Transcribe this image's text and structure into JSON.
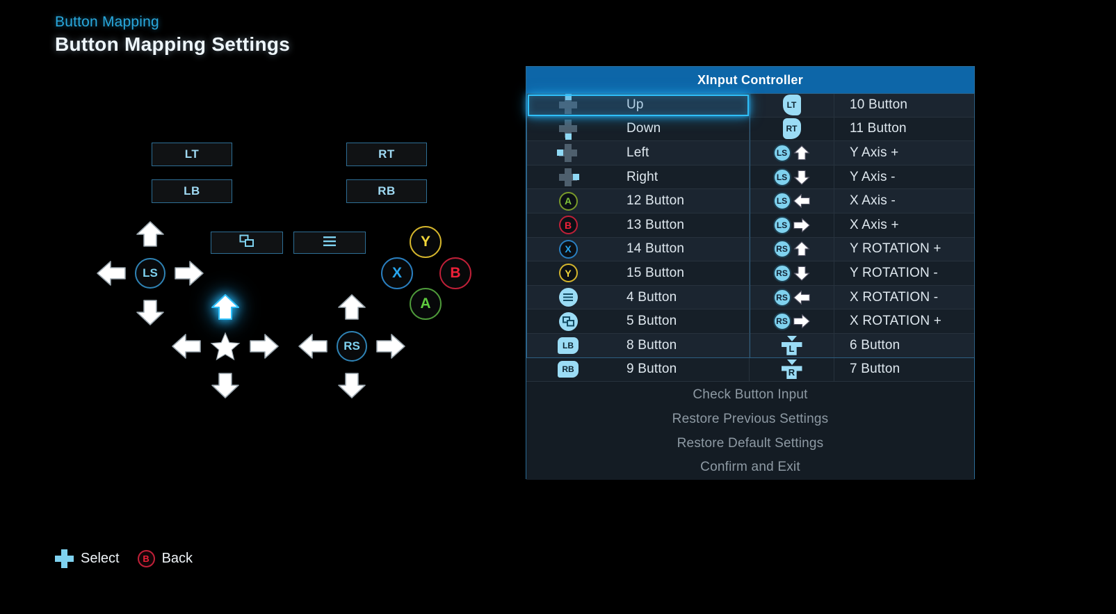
{
  "header": {
    "breadcrumb": "Button Mapping",
    "title": "Button Mapping Settings"
  },
  "controller_diagram": {
    "shoulders": [
      {
        "id": "lt",
        "label": "LT"
      },
      {
        "id": "lb",
        "label": "LB"
      },
      {
        "id": "rt",
        "label": "RT"
      },
      {
        "id": "rb",
        "label": "RB"
      }
    ],
    "center_buttons": [
      {
        "id": "view",
        "icon": "view-windows-icon"
      },
      {
        "id": "menu",
        "icon": "menu-hamburger-icon"
      }
    ],
    "left_stick": {
      "hub_label": "LS",
      "directions": [
        "up",
        "left",
        "right",
        "down"
      ]
    },
    "dpad": {
      "hub_icon": "star-icon",
      "directions": [
        "up",
        "left",
        "right",
        "down"
      ],
      "selected": "up"
    },
    "right_stick": {
      "hub_label": "RS",
      "directions": [
        "up",
        "left",
        "right",
        "down"
      ]
    },
    "face_buttons": [
      {
        "id": "y",
        "label": "Y",
        "color": "#f2d63a"
      },
      {
        "id": "x",
        "label": "X",
        "color": "#27a6ef"
      },
      {
        "id": "b",
        "label": "B",
        "color": "#ef2038"
      },
      {
        "id": "a",
        "label": "A",
        "color": "#5fcb3f"
      }
    ]
  },
  "panel": {
    "title": "XInput Controller",
    "selected_row_index": 0,
    "rows": [
      {
        "icon": "dpad-up-icon",
        "label": "Up",
        "icon2": "lt-trigger-icon",
        "label2": "10 Button"
      },
      {
        "icon": "dpad-down-icon",
        "label": "Down",
        "icon2": "rt-trigger-icon",
        "label2": "11 Button"
      },
      {
        "icon": "dpad-left-icon",
        "label": "Left",
        "icon2": "ls-up-icon",
        "label2": "Y Axis +"
      },
      {
        "icon": "dpad-right-icon",
        "label": "Right",
        "icon2": "ls-down-icon",
        "label2": "Y Axis -"
      },
      {
        "icon": "button-a-icon",
        "label": "12 Button",
        "icon2": "ls-left-icon",
        "label2": "X Axis -"
      },
      {
        "icon": "button-b-icon",
        "label": "13 Button",
        "icon2": "ls-right-icon",
        "label2": "X Axis +"
      },
      {
        "icon": "button-x-icon",
        "label": "14 Button",
        "icon2": "rs-up-icon",
        "label2": "Y ROTATION +"
      },
      {
        "icon": "button-y-icon",
        "label": "15 Button",
        "icon2": "rs-down-icon",
        "label2": "Y ROTATION -"
      },
      {
        "icon": "menu-hamburger-icon",
        "label": "4 Button",
        "icon2": "rs-left-icon",
        "label2": "X ROTATION -"
      },
      {
        "icon": "view-windows-icon",
        "label": "5 Button",
        "icon2": "rs-right-icon",
        "label2": "X ROTATION +"
      },
      {
        "icon": "lb-bumper-icon",
        "label": "8 Button",
        "icon2": "left-trigger-axis-icon",
        "label2": "6 Button"
      },
      {
        "icon": "rb-bumper-icon",
        "label": "9 Button",
        "icon2": "right-trigger-axis-icon",
        "label2": "7 Button"
      }
    ],
    "menu_items": [
      "Check Button Input",
      "Restore Previous Settings",
      "Restore Default Settings",
      "Confirm and Exit"
    ]
  },
  "footer": {
    "actions": [
      {
        "icon": "dpad-icon",
        "label": "Select"
      },
      {
        "icon": "button-b-icon",
        "label": "Back"
      }
    ]
  },
  "colors": {
    "accent_blue": "#29a8dd",
    "header_bar": "#0d66a8",
    "selection_glow": "#2fc0fb",
    "panel_bg": "#141c24",
    "row_alt": "#1b2530"
  }
}
